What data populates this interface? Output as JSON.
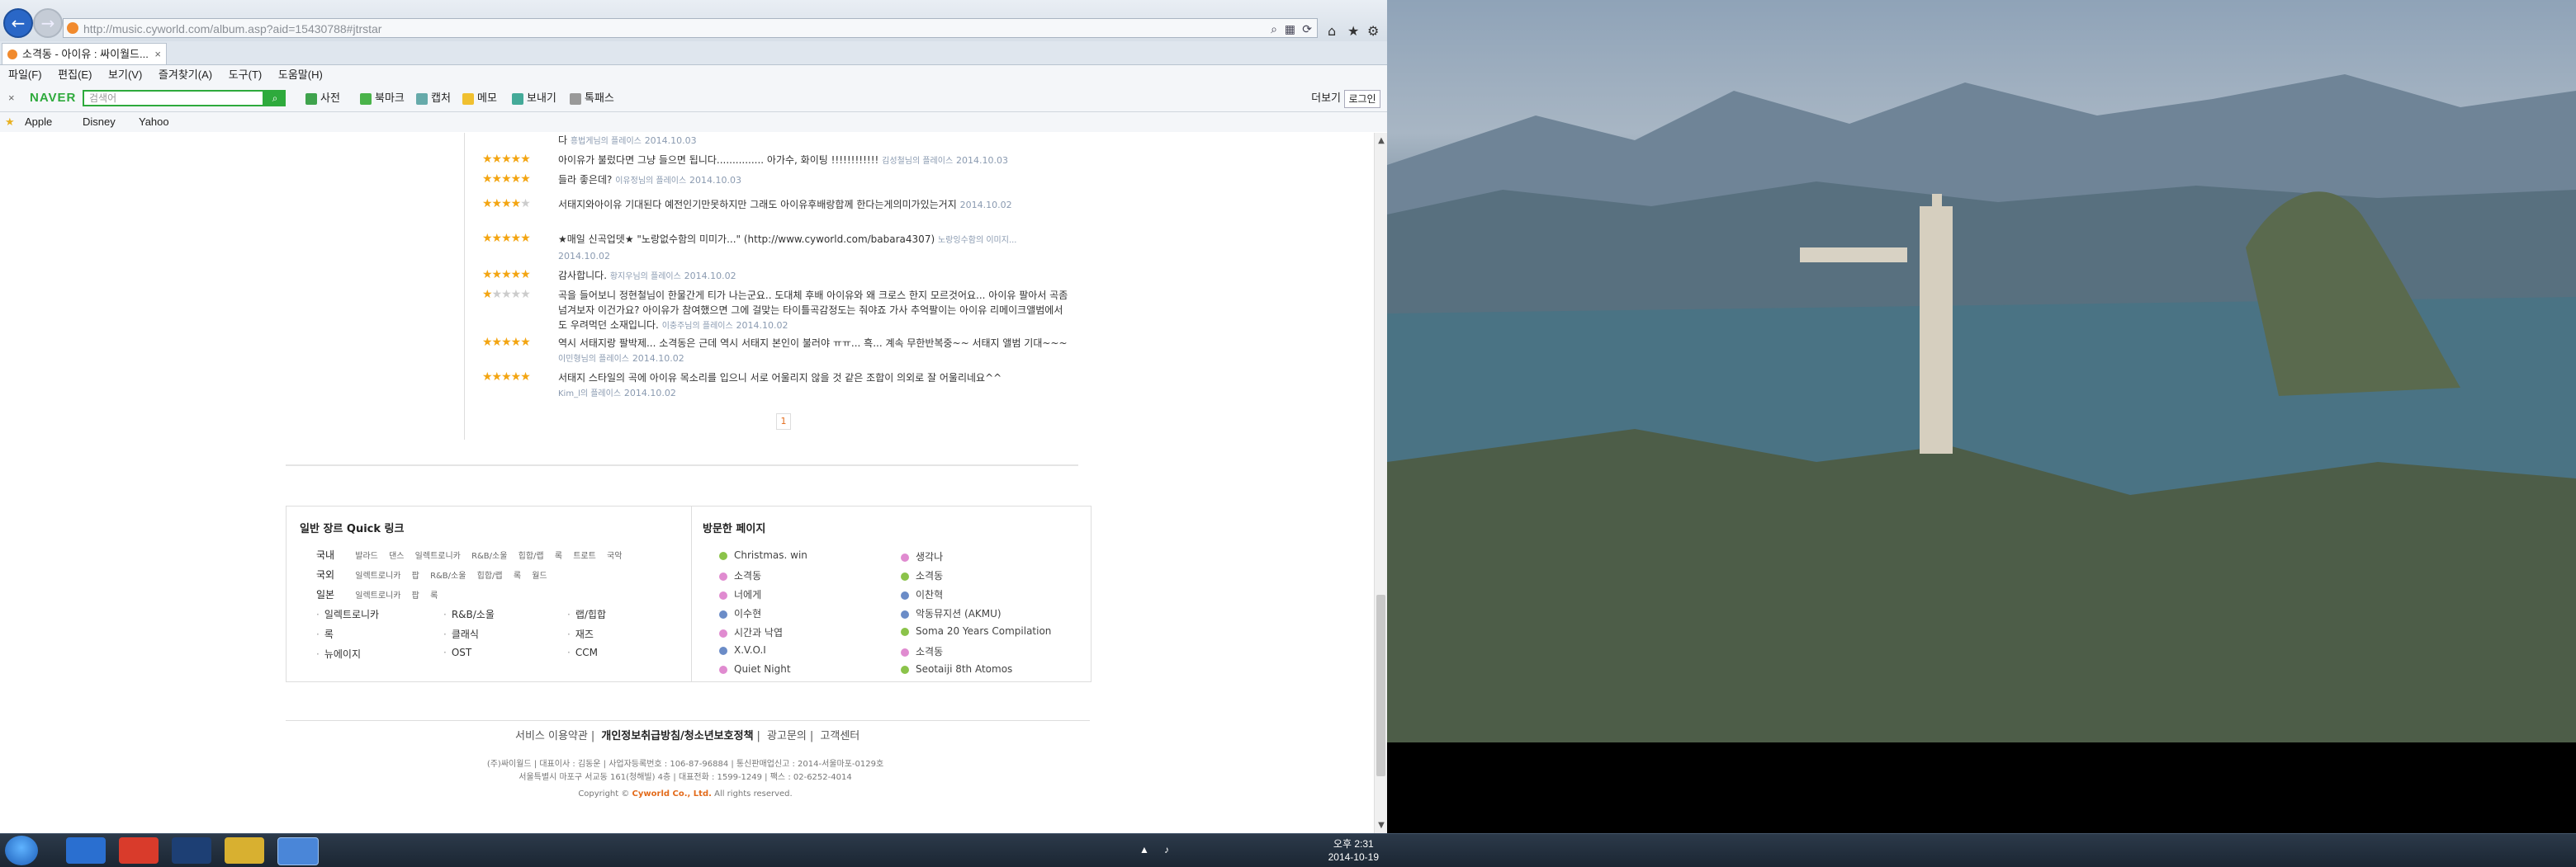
{
  "browser": {
    "url": "http://music.cyworld.com/album.asp?aid=15430788#jtrstar",
    "tab_title": "소격동 - 아이유 : 싸이월드...",
    "menu": [
      "파일(F)",
      "편집(E)",
      "보기(V)",
      "즐겨찾기(A)",
      "도구(T)",
      "도움말(H)"
    ],
    "toolbar": {
      "logo": "NAVER",
      "search_placeholder": "검색어",
      "items": [
        "사전",
        "북마크",
        "캡처",
        "메모",
        "보내기",
        "톡패스"
      ],
      "more": "더보기",
      "login": "로그인"
    },
    "favorites": [
      "Apple",
      "Disney",
      "Yahoo"
    ]
  },
  "comments": [
    {
      "stars": 5,
      "text": "다",
      "meta": "흥법게님의 플레이스",
      "date": "2014.10.03"
    },
    {
      "stars": 5,
      "text": "아이유가 불렀다면 그냥 들으면 됩니다............... 아가수, 화이팅 !!!!!!!!!!!!",
      "meta": "김성철님의 플레이스",
      "date": "2014.10.03"
    },
    {
      "stars": 5,
      "text": "들라 좋은데?",
      "meta": "이유정님의 플레이스",
      "date": "2014.10.03"
    },
    {
      "stars": 4,
      "text": "서태지와아이유 기대된다 예전인기만못하지만 그래도 아이유후배랑합께 한다는게의미가있는거지",
      "meta": "",
      "date": "2014.10.02"
    },
    {
      "stars": 5,
      "text": "★매일 신곡업뎃★ \"노랑없수함의 미미가...\" (http://www.cyworld.com/babara4307)",
      "meta": "노랑잉수함의 이미지...",
      "date": "2014.10.02"
    },
    {
      "stars": 5,
      "text": "감사합니다.",
      "meta": "황지우님의 플레이스",
      "date": "2014.10.02"
    },
    {
      "stars": 1,
      "text": "곡을 들어보니 정현철님이 한물간게 티가 나는군요.. 도대체 후배 아이유와 왜 크로스 한지 모르것어요... 아이유 팔아서 곡좀 넘겨보자 이건가요? 아이유가 참여했으면 그에 걸맞는 타이틀곡감정도는 줘야죠 가사 추억팔이는 아이유 리메이크앨범에서도 우려먹던 소재입니다.",
      "meta": "이충주님의 플레이스",
      "date": "2014.10.02"
    },
    {
      "stars": 5,
      "text": "역시 서태지랑 팔박제... 소격동은 근데 역시 서태지 본인이 불러야 ㅠㅠ... 흑... 계속 무한반복중~~ 서태지 앨범 기대~~~",
      "meta": "이민형님의 플레이스",
      "date": "2014.10.02"
    },
    {
      "stars": 5,
      "text": "서태지 스타일의 곡에 아이유 목소리를 입으니 서로 어울리지 않을 것 같은 조합이 의외로 잘 어울리네요^^",
      "meta": "Kim_l의 플레이스",
      "date": "2014.10.02"
    }
  ],
  "pager": "1",
  "quick": {
    "title": "일반 장르 Quick 링크",
    "rows": [
      {
        "cat": "국내",
        "subs": [
          "발라드",
          "댄스",
          "일렉트로니카",
          "R&B/소울",
          "힙합/랩",
          "록",
          "트로트",
          "국악"
        ]
      },
      {
        "cat": "국외",
        "subs": [
          "일렉트로니카",
          "팝",
          "R&B/소울",
          "힙합/랩",
          "록",
          "월드"
        ]
      },
      {
        "cat": "일본",
        "subs": [
          "일렉트로니카",
          "팝",
          "록"
        ]
      }
    ],
    "genres": [
      "일렉트로니카",
      "R&B/소울",
      "랩/힙합",
      "록",
      "클래식",
      "재즈",
      "뉴에이지",
      "OST",
      "CCM"
    ]
  },
  "visited": {
    "title": "방문한 페이지",
    "col1": [
      "Christmas. win",
      "소격동",
      "너에게",
      "이수현",
      "시간과 낙엽",
      "X.V.O.I",
      "Quiet Night"
    ],
    "col2": [
      "생각나",
      "소격동",
      "이찬혁",
      "악동뮤지션 (AKMU)",
      "Soma 20 Years Compilation",
      "소격동",
      "Seotaiji 8th Atomos"
    ]
  },
  "footer": {
    "links": [
      "서비스 이용약관",
      "개인정보취급방침/청소년보호정책",
      "광고문의",
      "고객센터"
    ],
    "addr1": "(주)싸이월드 | 대표이사 : 김동운 | 사업자등록번호 : 106-87-96884 | 통신판매업신고 : 2014-서울마포-0129호",
    "addr2": "서울특별시 마포구 서교동 161(청해빌) 4층 | 대표전화 : 1599-1249 | 팩스 : 02-6252-4014",
    "copyright_pre": "Copyright ©",
    "copyright_brand": "Cyworld Co., Ltd.",
    "copyright_post": "All rights reserved."
  },
  "clock": {
    "time": "오후 2:31",
    "date": "2014-10-19"
  }
}
